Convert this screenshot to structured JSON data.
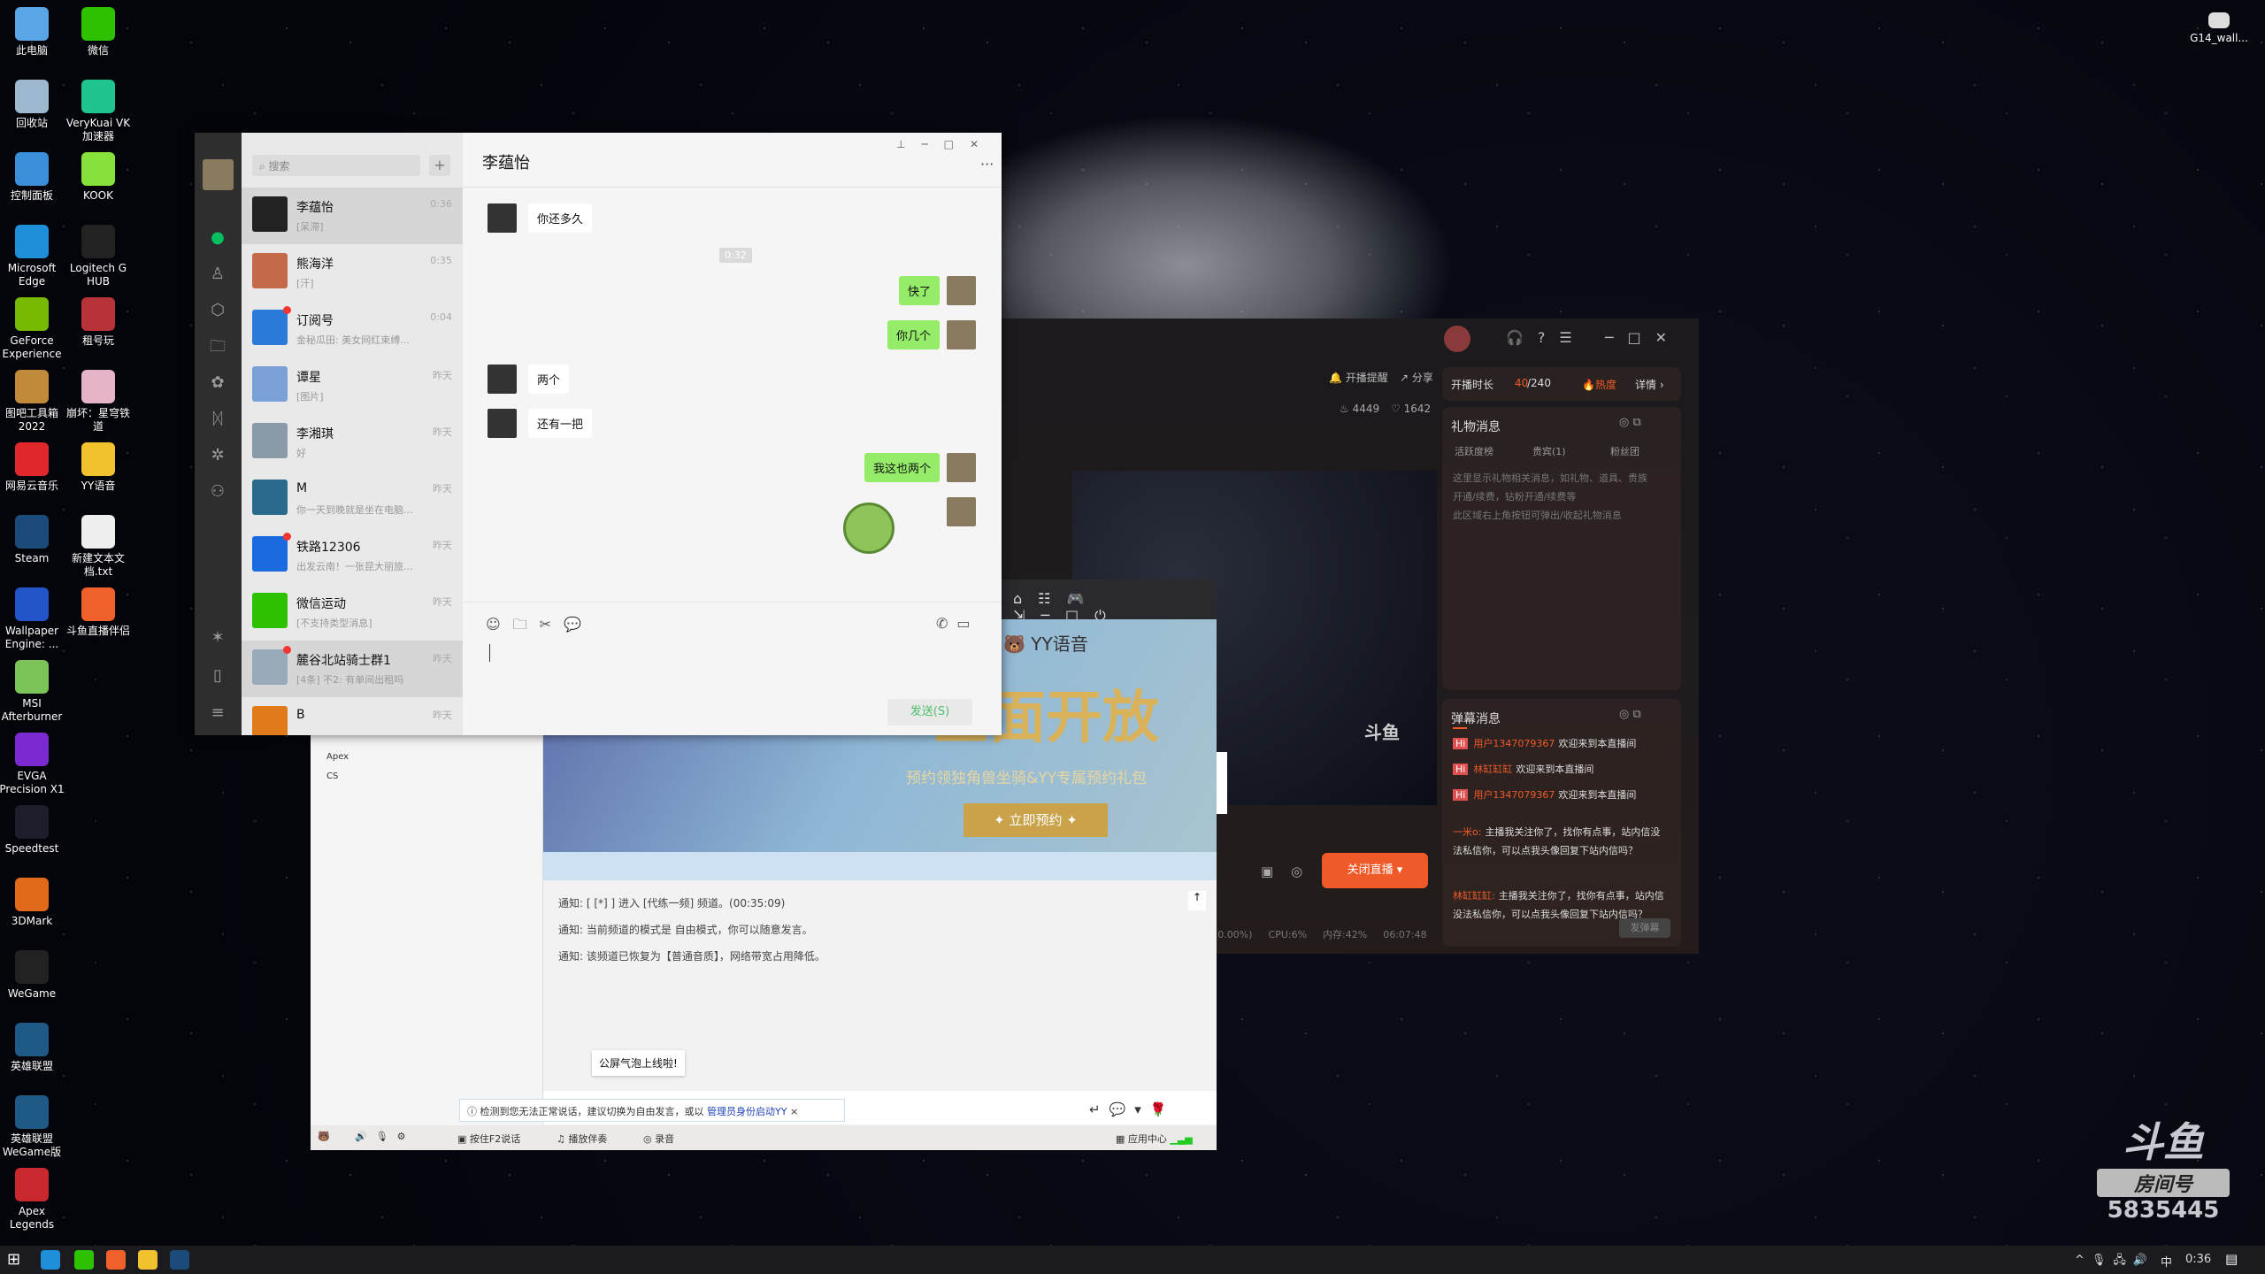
{
  "desktop": {
    "icons": [
      {
        "label": "此电脑",
        "color": "#5aa6e6"
      },
      {
        "label": "微信",
        "color": "#2dc100"
      },
      {
        "label": "回收站",
        "color": "#9db8cf"
      },
      {
        "label": "VeryKuai VK 加速器",
        "color": "#1fc48e"
      },
      {
        "label": "控制面板",
        "color": "#3a8fd8"
      },
      {
        "label": "KOOK",
        "color": "#86e23a"
      },
      {
        "label": "Microsoft Edge",
        "color": "#1e8fd8"
      },
      {
        "label": "Logitech G HUB",
        "color": "#222"
      },
      {
        "label": "GeForce Experience",
        "color": "#76b900"
      },
      {
        "label": "租号玩",
        "color": "#b8323a"
      },
      {
        "label": "图吧工具箱 2022",
        "color": "#c08a3a"
      },
      {
        "label": "崩坏：星穹铁道",
        "color": "#e6b4c8"
      },
      {
        "label": "网易云音乐",
        "color": "#e0282c"
      },
      {
        "label": "YY语音",
        "color": "#f2c12e"
      },
      {
        "label": "Steam",
        "color": "#1b4b78"
      },
      {
        "label": "新建文本文档.txt",
        "color": "#eeeeee"
      },
      {
        "label": "Wallpaper Engine: ...",
        "color": "#2353c8"
      },
      {
        "label": "斗鱼直播伴侣",
        "color": "#f0602a"
      },
      {
        "label": "MSI Afterburner",
        "color": "#7ac45a"
      },
      {
        "label": "EVGA Precision X1",
        "color": "#7a2ad0"
      },
      {
        "label": "Speedtest",
        "color": "#1d1d2b"
      },
      {
        "label": "3DMark",
        "color": "#e06a1a"
      },
      {
        "label": "WeGame",
        "color": "#222"
      },
      {
        "label": "英雄联盟",
        "color": "#1f5a86"
      },
      {
        "label": "英雄联盟 WeGame版",
        "color": "#1f5a86"
      },
      {
        "label": "Apex Legends",
        "color": "#c8282e"
      }
    ],
    "topright_icon": "G14_wall..."
  },
  "wechat": {
    "search_placeholder": "搜索",
    "add": "+",
    "nav_icons": [
      "chat-icon",
      "contacts-icon",
      "favorites-icon",
      "files-icon",
      "moments-icon",
      "channels-icon",
      "search-mini-icon",
      "live-icon",
      "miniprogram-icon",
      "phone-icon",
      "menu-icon"
    ],
    "chats": [
      {
        "name": "李蕴怡",
        "preview": "[呆滞]",
        "time": "0:36",
        "unread": false,
        "color": "#222"
      },
      {
        "name": "熊海洋",
        "preview": "[汗]",
        "time": "0:35",
        "unread": false,
        "color": "#c46a4a"
      },
      {
        "name": "订阅号",
        "preview": "金秘瓜田: 美女网红束缚...",
        "time": "0:04",
        "unread": true,
        "color": "#2a7ad8"
      },
      {
        "name": "谭星",
        "preview": "[图片]",
        "time": "昨天",
        "unread": false,
        "color": "#7aa0d8"
      },
      {
        "name": "李湘琪",
        "preview": "好",
        "time": "昨天",
        "unread": false,
        "color": "#8a9aa8"
      },
      {
        "name": "M",
        "preview": "你一天到晚就是坐在电脑...",
        "time": "昨天",
        "unread": false,
        "color": "#2a6a8a"
      },
      {
        "name": "铁路12306",
        "preview": "出发云南！一张昆大丽旅...",
        "time": "昨天",
        "unread": true,
        "color": "#1a6ae0"
      },
      {
        "name": "微信运动",
        "preview": "[不支持类型消息]",
        "time": "昨天",
        "unread": false,
        "color": "#2dc100"
      },
      {
        "name": "麓谷北站骑士群1",
        "preview": "[4条] 不2: 有单间出租吗",
        "time": "昨天",
        "unread": true,
        "color": "#9ab"
      },
      {
        "name": "B",
        "preview": "",
        "time": "昨天",
        "unread": false,
        "color": "#e07a1a"
      }
    ],
    "title": "李蕴怡",
    "more": "···",
    "messages": [
      {
        "dir": "in",
        "text": "你还多久"
      },
      {
        "dir": "time",
        "text": "0:32"
      },
      {
        "dir": "out",
        "text": "快了"
      },
      {
        "dir": "out",
        "text": "你几个"
      },
      {
        "dir": "in",
        "text": "两个"
      },
      {
        "dir": "in",
        "text": "还有一把"
      },
      {
        "dir": "out",
        "text": "我这也两个"
      }
    ],
    "send": "发送(S)"
  },
  "douyu": {
    "remind": "开播提醒",
    "share": "分享",
    "hot_count": "4449",
    "likes": "1642",
    "duration_label": "开播时长",
    "duration_value": "40",
    "duration_total": "/240",
    "heat": "热度",
    "details": "详情 ›",
    "gift_title": "礼物消息",
    "gift_tabs": [
      "活跃度榜",
      "贵宾(1)",
      "粉丝团"
    ],
    "gift_desc": [
      "这里显示礼物相关消息，如礼物、道具、贵族",
      "开通/续费，钻粉开通/续费等",
      "此区域右上角按钮可弹出/收起礼物消息"
    ],
    "danmu_title": "弹幕消息",
    "welcomes": [
      {
        "user": "用户1347079367",
        "text": "欢迎来到本直播间"
      },
      {
        "user": "林缸缸缸",
        "text": "欢迎来到本直播间"
      },
      {
        "user": "用户1347079367",
        "text": "欢迎来到本直播间"
      }
    ],
    "comments": [
      {
        "user": "一米o:",
        "text": "主播我关注你了，找你有点事，站内信没法私信你，可以点我头像回复下站内信吗？"
      },
      {
        "user": "林缸缸缸:",
        "text": "主播我关注你了，找你有点事，站内信没法私信你，可以点我头像回复下站内信吗？"
      }
    ],
    "send_danmu": "发弹幕",
    "stop_live": "关闭直播 ▾",
    "stats": [
      "(0.00%)",
      "CPU:6%",
      "内存:42%",
      "06:07:48"
    ],
    "room_label": "房间号",
    "room_number": "5835445",
    "accent": "#f05a28"
  },
  "yy": {
    "logo": "YY语音",
    "banner_title": "全面开放",
    "banner_sub": "预约领独角兽坐骑&YY专属预约礼包",
    "banner_btn": "✦ 立即预约 ✦",
    "channels": [
      "Apex",
      "CS"
    ],
    "notices": [
      "通知: [ [*] ] 进入 [代练一频] 频道。(00:35:09)",
      "通知: 当前频道的模式是 自由模式，你可以随意发言。",
      "通知: 该频道已恢复为【普通音质】，网络带宽占用降低。"
    ],
    "bubble": "公屏气泡上线啦!",
    "tip": "检测到您无法正常说话，建议切换为自由发言，或以",
    "tip_link": "管理员身份启动YY",
    "bottom": {
      "f2": "按住F2说话",
      "music": "播放伴奏",
      "record": "录音",
      "apps": "应用中心"
    }
  },
  "taskbar": {
    "time": "0:36",
    "ime": "中"
  }
}
